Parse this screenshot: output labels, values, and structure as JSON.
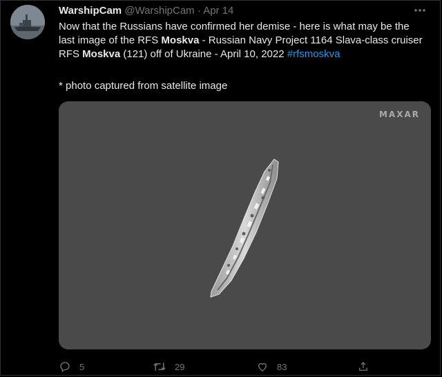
{
  "tweet": {
    "display_name": "WarshipCam",
    "handle": "@WarshipCam",
    "separator": "·",
    "date": "Apr 14",
    "text_part1": "Now that the Russians have confirmed her demise - here is what may be the last image of the RFS ",
    "bold1": "Moskva",
    "text_part2": " - Russian Navy Project 1164 Slava-class cruiser RFS ",
    "bold2": "Moskva",
    "text_part3": " (121) off of Ukraine - April 10, 2022 ",
    "hashtag": "#rfsmoskva",
    "note": "* photo captured from satellite image"
  },
  "media": {
    "watermark": "MAXAR"
  },
  "actions": {
    "replies": "5",
    "retweets": "29",
    "likes": "83"
  },
  "icons": {
    "more": "more-dots-icon",
    "reply": "reply-icon",
    "retweet": "retweet-icon",
    "like": "heart-icon",
    "share": "share-icon"
  },
  "colors": {
    "background": "#000000",
    "text": "#e7e9ea",
    "muted": "#71767b",
    "link": "#1d9bf0",
    "media_bg": "#4a4a4a"
  }
}
